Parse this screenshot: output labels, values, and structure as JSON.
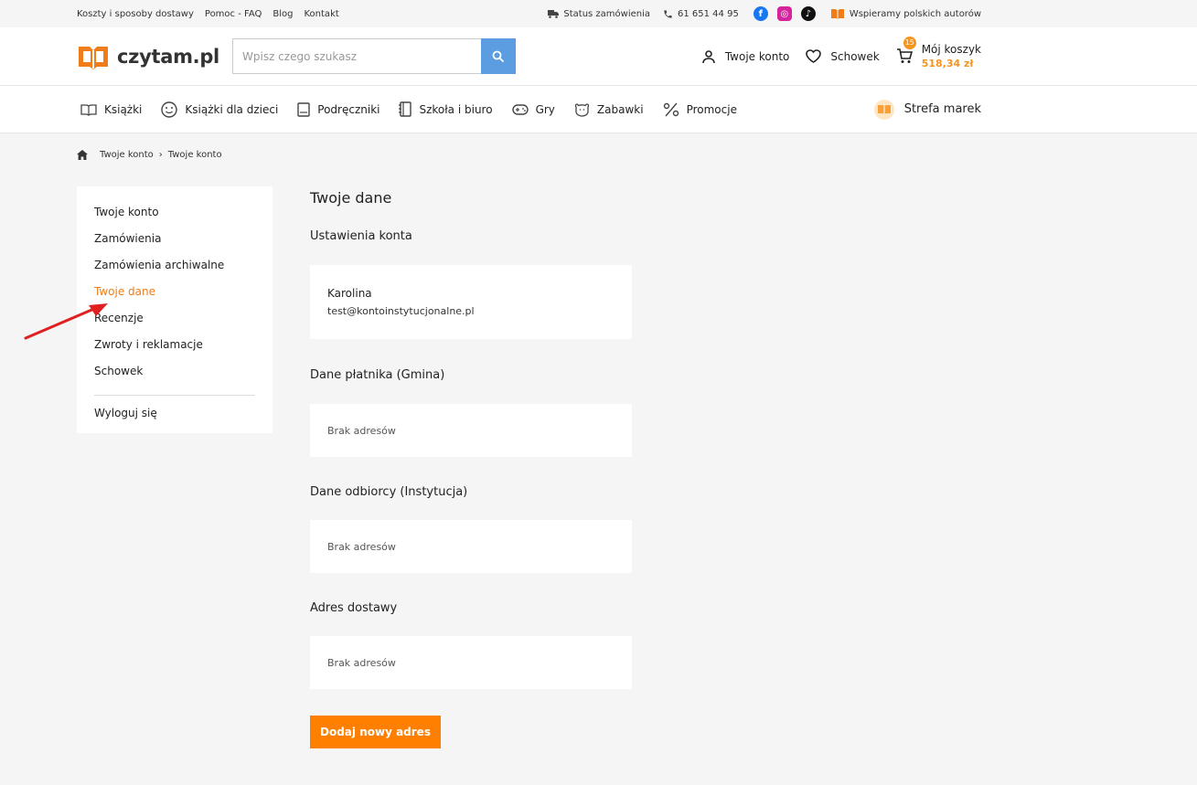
{
  "topbar": {
    "links": [
      "Koszty i sposoby dostawy",
      "Pomoc - FAQ",
      "Blog",
      "Kontakt"
    ],
    "status": "Status zamówienia",
    "phone": "61 651 44 95",
    "support": "Wspieramy polskich autorów"
  },
  "header": {
    "logo_text": "czytam.pl",
    "search_placeholder": "Wpisz czego szukasz",
    "account": "Twoje konto",
    "wishlist": "Schowek",
    "cart_label": "Mój koszyk",
    "cart_price": "518,34 zł",
    "cart_count": "15"
  },
  "nav": {
    "items": [
      "Książki",
      "Książki dla dzieci",
      "Podręczniki",
      "Szkoła i biuro",
      "Gry",
      "Zabawki",
      "Promocje"
    ],
    "brand": "Strefa marek"
  },
  "breadcrumb": [
    "Twoje konto",
    "Twoje konto"
  ],
  "sidebar": {
    "items": [
      "Twoje konto",
      "Zamówienia",
      "Zamówienia archiwalne",
      "Twoje dane",
      "Recenzje",
      "Zwroty i reklamacje",
      "Schowek"
    ],
    "logout": "Wyloguj się",
    "active": "Twoje dane"
  },
  "main": {
    "title": "Twoje dane",
    "account_settings": "Ustawienia konta",
    "user_name": "Karolina",
    "user_email": "test@kontoinstytucjonalne.pl",
    "payer_title": "Dane płatnika (Gmina)",
    "payer_empty": "Brak adresów",
    "recipient_title": "Dane odbiorcy (Instytucja)",
    "recipient_empty": "Brak adresów",
    "delivery_title": "Adres dostawy",
    "delivery_empty": "Brak adresów",
    "add_button": "Dodaj nowy adres"
  },
  "colors": {
    "accent": "#ff7f00",
    "active_link": "#f07d1a",
    "search_button": "#5b9de0",
    "arrow": "#e02020"
  }
}
